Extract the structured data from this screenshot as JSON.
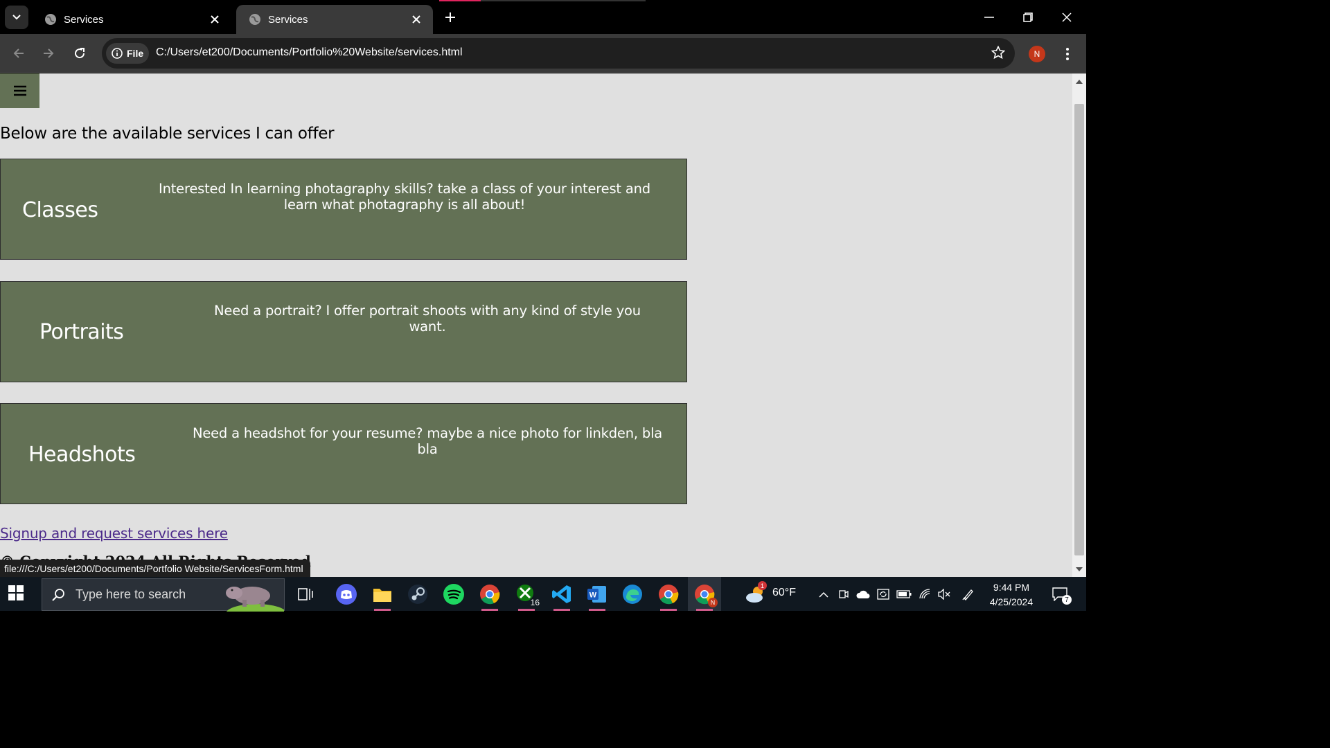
{
  "browser": {
    "tabs": [
      {
        "title": "Services",
        "active": false
      },
      {
        "title": "Services",
        "active": true
      }
    ],
    "address_chip": "File",
    "url": "C:/Users/et200/Documents/Portfolio%20Website/services.html",
    "profile_initial": "N",
    "status_url": "file:///C:/Users/et200/Documents/Portfolio Website/ServicesForm.html"
  },
  "page": {
    "intro": "Below are the available services I can offer",
    "services": [
      {
        "title": "Classes",
        "description": "Interested In learning photagraphy skills? take a class of your interest and learn what photagraphy is all about!"
      },
      {
        "title": "Portraits",
        "description": "Need a portrait? I offer portrait shoots with any kind of style you want."
      },
      {
        "title": "Headshots",
        "description": "Need a headshot for your resume? maybe a nice photo for linkden, bla bla"
      }
    ],
    "signup_link": "Signup and request services here",
    "footer_partial": "© Copyright 2024 All Rights Reserved"
  },
  "colors": {
    "card_bg": "#637155",
    "page_bg": "#e0e0e0",
    "link": "#4b2a8a"
  },
  "taskbar": {
    "search_placeholder": "Type here to search",
    "xbox_badge": "16",
    "weather_temp": "60°F",
    "weather_badge": "1",
    "time": "9:44 PM",
    "date": "4/25/2024",
    "notification_count": "7",
    "chrome_profile_badge": "N",
    "icons": [
      "task-view-icon",
      "discord-icon",
      "file-explorer-icon",
      "steam-icon",
      "spotify-icon",
      "chrome-icon",
      "xbox-icon",
      "vscode-icon",
      "word-icon",
      "edge-icon",
      "chrome-icon",
      "chrome-profile-icon"
    ]
  }
}
